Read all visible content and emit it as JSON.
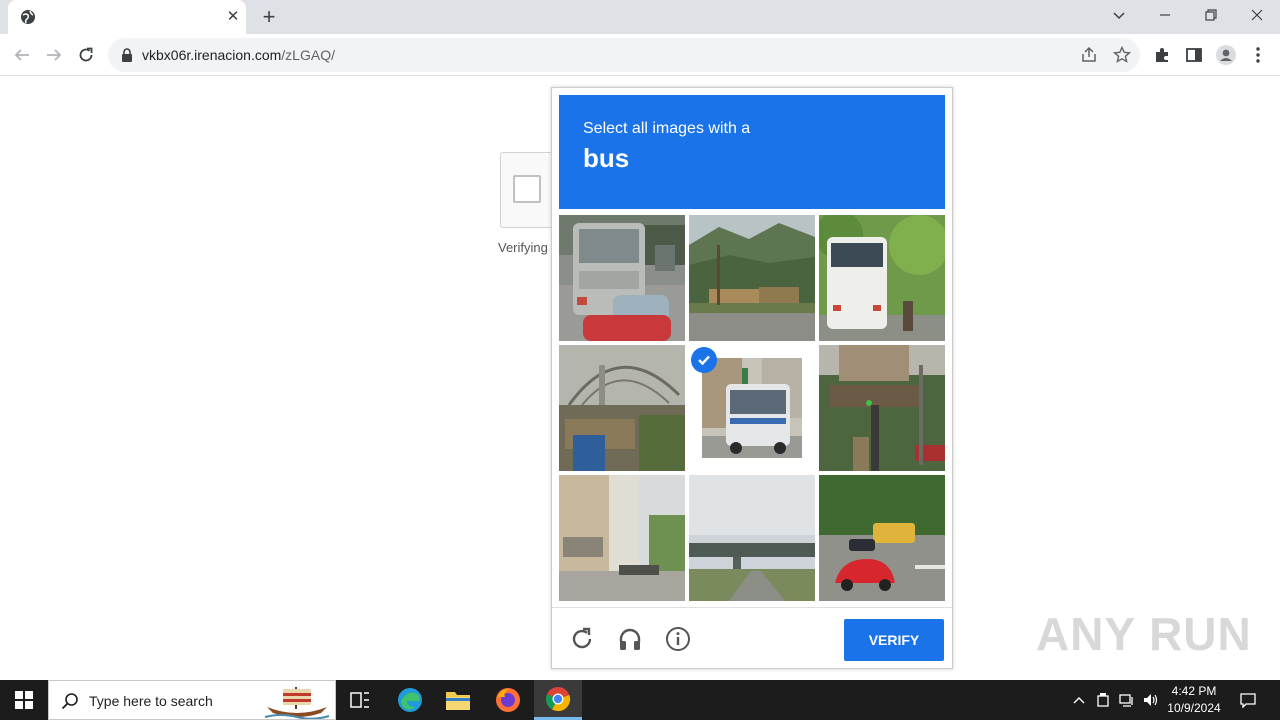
{
  "browser": {
    "tab_close_label": "✕",
    "new_tab_label": "+",
    "url_host": "vkbx06r.irenacion.com",
    "url_path": "/zLGAQ/"
  },
  "page": {
    "verifying_text": "Verifying"
  },
  "challenge": {
    "instruction": "Select all images with a",
    "target_word": "bus",
    "verify_label": "VERIFY",
    "tiles": [
      {
        "subject": "bus rear in traffic",
        "selected": false
      },
      {
        "subject": "street with mountains",
        "selected": false
      },
      {
        "subject": "white bus rear",
        "selected": false
      },
      {
        "subject": "metal structure",
        "selected": false
      },
      {
        "subject": "city bus",
        "selected": true
      },
      {
        "subject": "traffic light and building",
        "selected": false
      },
      {
        "subject": "street with buildings",
        "selected": false
      },
      {
        "subject": "highway overpass",
        "selected": false
      },
      {
        "subject": "road with yellow bus and red car",
        "selected": false
      }
    ]
  },
  "watermark": "ANY RUN",
  "taskbar": {
    "search_placeholder": "Type here to search",
    "time": "4:42 PM",
    "date": "10/9/2024"
  },
  "colors": {
    "accent": "#1a73e8",
    "taskbar": "#1c1c1c"
  }
}
